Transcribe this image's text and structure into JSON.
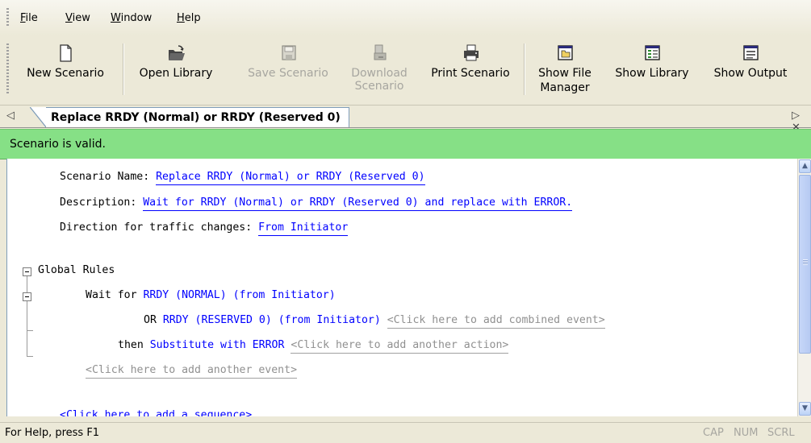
{
  "menu": {
    "file": {
      "accel": "F",
      "rest": "ile"
    },
    "view": {
      "accel": "V",
      "rest": "iew"
    },
    "window": {
      "accel": "W",
      "rest": "indow"
    },
    "help": {
      "accel": "H",
      "rest": "elp"
    }
  },
  "toolbar": {
    "new_scenario": "New Scenario",
    "open_library": "Open Library",
    "save_scenario": "Save Scenario",
    "download_1": "Download",
    "download_2": "Scenario",
    "print_scenario": "Print Scenario",
    "show_file_1": "Show File",
    "show_file_2": "Manager",
    "show_library": "Show Library",
    "show_output": "Show Output"
  },
  "tabs": {
    "active": "Replace RRDY (Normal) or RRDY (Reserved 0)",
    "left_arrow": "◁",
    "right_arrows": "▷ ✕"
  },
  "status": {
    "valid_text": "Scenario is valid.",
    "valid_color": "#86e086"
  },
  "scenario": {
    "name_label": "Scenario Name: ",
    "name_value": "Replace RRDY (Normal) or RRDY (Reserved 0)",
    "desc_label": "Description: ",
    "desc_value": "Wait for RRDY (Normal) or RRDY (Reserved 0) and replace with ERROR.",
    "direction_label": "Direction for traffic changes: ",
    "direction_value": "From Initiator"
  },
  "rules": {
    "global_rules": "Global Rules",
    "wait_for": "Wait for ",
    "event1": "RRDY (NORMAL) (from Initiator)",
    "or_label": "OR ",
    "event2": "RRDY (RESERVED 0) (from Initiator)",
    "add_combined": "<Click here to add combined event>",
    "then_label": "then ",
    "action": "Substitute with ERROR",
    "add_action": "<Click here to add another action>",
    "add_event": "<Click here to add another event>",
    "add_sequence": "<Click here to add a sequence>"
  },
  "statusbar": {
    "help": "For Help, press F1",
    "cap": "CAP",
    "num": "NUM",
    "scrl": "SCRL"
  }
}
